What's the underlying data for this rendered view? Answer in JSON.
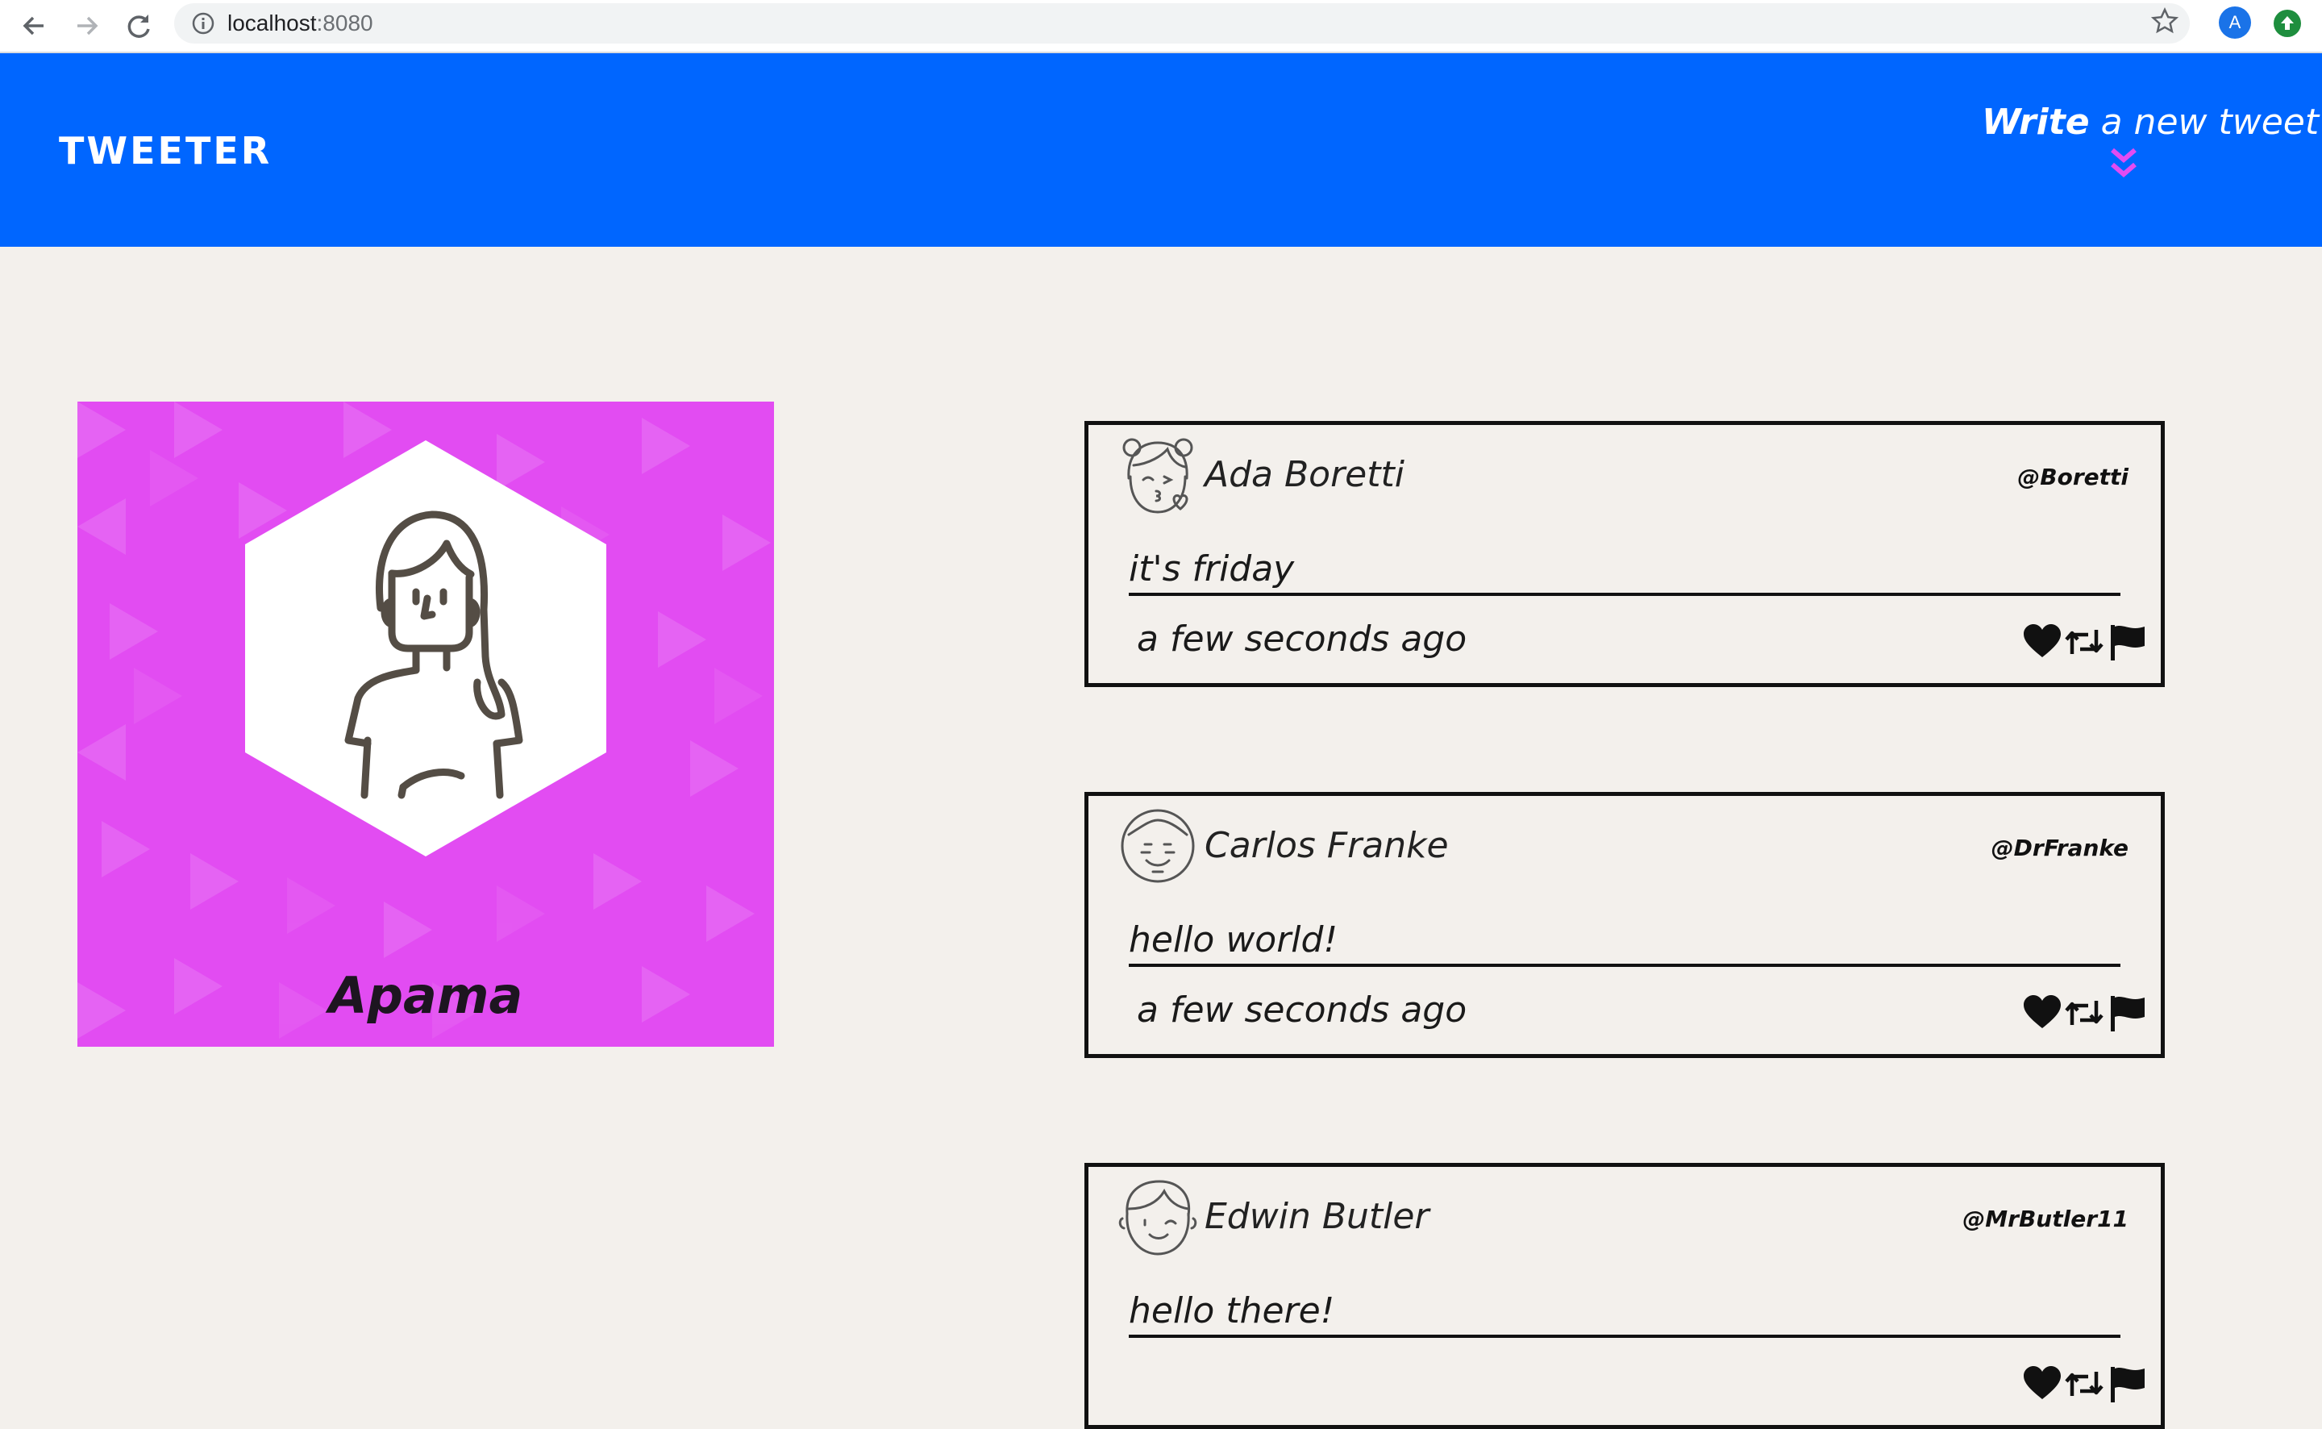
{
  "browser": {
    "url_host": "localhost",
    "url_port": ":8080",
    "profile_initial": "A"
  },
  "header": {
    "brand": "TWEETER",
    "write_strong": "Write",
    "write_rest": " a new tweet",
    "background_color": "#0066ff",
    "accent_color": "#e24cf2"
  },
  "profile": {
    "name": "Apama",
    "card_color": "#e24cf2"
  },
  "tweets": [
    {
      "name": "Ada Boretti",
      "handle": "@Boretti",
      "text": "it's friday",
      "time": "a few seconds ago",
      "avatar_icon": "girl-kiss-face-icon"
    },
    {
      "name": "Carlos Franke",
      "handle": "@DrFranke",
      "text": "hello world!",
      "time": "a few seconds ago",
      "avatar_icon": "man-smile-face-icon"
    },
    {
      "name": "Edwin Butler",
      "handle": "@MrButler11",
      "text": "hello there!",
      "time": "",
      "avatar_icon": "boy-wink-face-icon"
    }
  ],
  "icons": {
    "like": "heart-icon",
    "retweet": "retweet-icon",
    "flag": "flag-icon"
  }
}
